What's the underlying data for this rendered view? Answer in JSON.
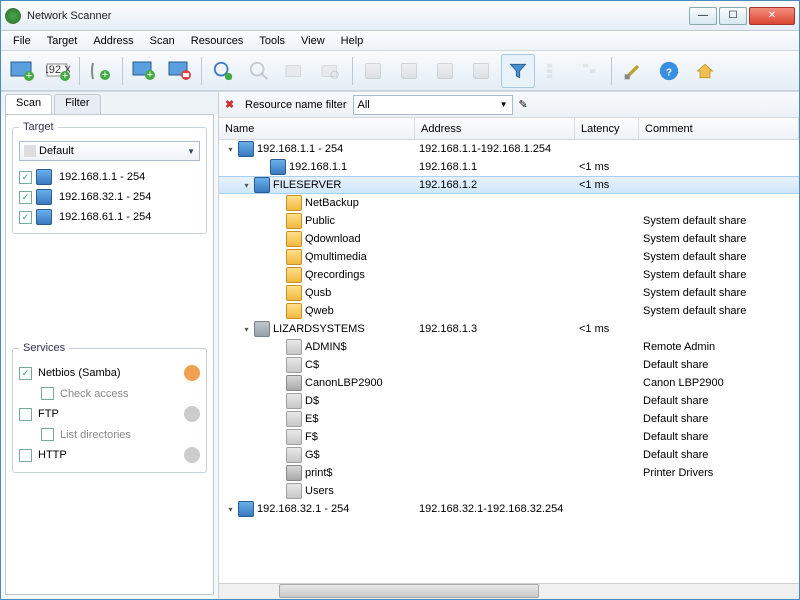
{
  "window": {
    "title": "Network Scanner"
  },
  "menu": [
    "File",
    "Target",
    "Address",
    "Scan",
    "Resources",
    "Tools",
    "View",
    "Help"
  ],
  "sidebar": {
    "tabs": [
      "Scan",
      "Filter"
    ],
    "target": {
      "legend": "Target",
      "combo": "Default",
      "items": [
        {
          "checked": true,
          "label": "192.168.1.1 - 254"
        },
        {
          "checked": true,
          "label": "192.168.32.1 - 254"
        },
        {
          "checked": true,
          "label": "192.168.61.1 - 254"
        }
      ]
    },
    "services": {
      "legend": "Services",
      "items": [
        {
          "checked": true,
          "label": "Netbios (Samba)",
          "sub": "Check access",
          "subchecked": false
        },
        {
          "checked": false,
          "label": "FTP",
          "sub": "List directories",
          "subchecked": false
        },
        {
          "checked": false,
          "label": "HTTP"
        }
      ]
    }
  },
  "filterbar": {
    "label": "Resource name filter",
    "combo": "All"
  },
  "columns": [
    "Name",
    "Address",
    "Latency",
    "Comment"
  ],
  "rows": [
    {
      "indent": 0,
      "exp": "▾",
      "icon": "monitor",
      "name": "192.168.1.1 - 254",
      "addr": "192.168.1.1-192.168.1.254",
      "lat": "",
      "com": ""
    },
    {
      "indent": 2,
      "exp": "",
      "icon": "monitor",
      "name": "192.168.1.1",
      "addr": "192.168.1.1",
      "lat": "<1 ms",
      "com": ""
    },
    {
      "indent": 1,
      "exp": "▾",
      "icon": "monitor",
      "name": "FILESERVER",
      "addr": "192.168.1.2",
      "lat": "<1 ms",
      "com": "",
      "sel": true
    },
    {
      "indent": 3,
      "exp": "",
      "icon": "folder",
      "name": "NetBackup",
      "addr": "",
      "lat": "",
      "com": ""
    },
    {
      "indent": 3,
      "exp": "",
      "icon": "folder",
      "name": "Public",
      "addr": "",
      "lat": "",
      "com": "System default share"
    },
    {
      "indent": 3,
      "exp": "",
      "icon": "folder",
      "name": "Qdownload",
      "addr": "",
      "lat": "",
      "com": "System default share"
    },
    {
      "indent": 3,
      "exp": "",
      "icon": "folder",
      "name": "Qmultimedia",
      "addr": "",
      "lat": "",
      "com": "System default share"
    },
    {
      "indent": 3,
      "exp": "",
      "icon": "folder",
      "name": "Qrecordings",
      "addr": "",
      "lat": "",
      "com": "System default share"
    },
    {
      "indent": 3,
      "exp": "",
      "icon": "folder",
      "name": "Qusb",
      "addr": "",
      "lat": "",
      "com": "System default share"
    },
    {
      "indent": 3,
      "exp": "",
      "icon": "folder",
      "name": "Qweb",
      "addr": "",
      "lat": "",
      "com": "System default share"
    },
    {
      "indent": 1,
      "exp": "▾",
      "icon": "monitor-g",
      "name": "LIZARDSYSTEMS",
      "addr": "192.168.1.3",
      "lat": "<1 ms",
      "com": ""
    },
    {
      "indent": 3,
      "exp": "",
      "icon": "folder-g",
      "name": "ADMIN$",
      "addr": "",
      "lat": "",
      "com": "Remote Admin"
    },
    {
      "indent": 3,
      "exp": "",
      "icon": "folder-g",
      "name": "C$",
      "addr": "",
      "lat": "",
      "com": "Default share"
    },
    {
      "indent": 3,
      "exp": "",
      "icon": "printer",
      "name": "CanonLBP2900",
      "addr": "",
      "lat": "",
      "com": "Canon LBP2900"
    },
    {
      "indent": 3,
      "exp": "",
      "icon": "folder-g",
      "name": "D$",
      "addr": "",
      "lat": "",
      "com": "Default share"
    },
    {
      "indent": 3,
      "exp": "",
      "icon": "folder-g",
      "name": "E$",
      "addr": "",
      "lat": "",
      "com": "Default share"
    },
    {
      "indent": 3,
      "exp": "",
      "icon": "folder-g",
      "name": "F$",
      "addr": "",
      "lat": "",
      "com": "Default share"
    },
    {
      "indent": 3,
      "exp": "",
      "icon": "folder-g",
      "name": "G$",
      "addr": "",
      "lat": "",
      "com": "Default share"
    },
    {
      "indent": 3,
      "exp": "",
      "icon": "printer",
      "name": "print$",
      "addr": "",
      "lat": "",
      "com": "Printer Drivers"
    },
    {
      "indent": 3,
      "exp": "",
      "icon": "folder-g",
      "name": "Users",
      "addr": "",
      "lat": "",
      "com": ""
    },
    {
      "indent": 0,
      "exp": "▾",
      "icon": "monitor",
      "name": "192.168.32.1 - 254",
      "addr": "192.168.32.1-192.168.32.254",
      "lat": "",
      "com": ""
    }
  ]
}
